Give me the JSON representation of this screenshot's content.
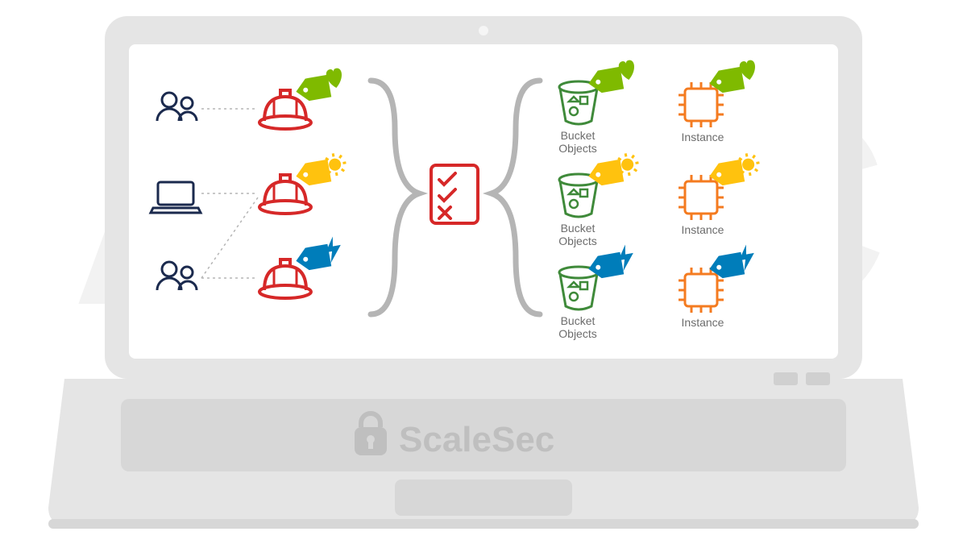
{
  "background_text": "ABAC",
  "brand": "ScaleSec",
  "resource_labels": {
    "bucket": "Bucket Objects",
    "instance": "Instance"
  },
  "colors": {
    "green": "#7fba00",
    "yellow": "#ffc20e",
    "teal": "#007dba",
    "red": "#d62828",
    "orange": "#f47b20",
    "bucket_green": "#3f8a3a",
    "gray": "#a8a8a8",
    "dark_navy": "#1b2a4e",
    "light_gray": "#e5e5e5"
  },
  "subjects": [
    {
      "type": "users",
      "tag": "green-heart"
    },
    {
      "type": "laptop",
      "tag": "yellow-sun"
    },
    {
      "type": "users",
      "tag": "teal-bolt"
    }
  ],
  "resources": [
    {
      "kind": "bucket",
      "tag": "green-heart"
    },
    {
      "kind": "instance",
      "tag": "green-heart"
    },
    {
      "kind": "bucket",
      "tag": "yellow-sun"
    },
    {
      "kind": "instance",
      "tag": "yellow-sun"
    },
    {
      "kind": "bucket",
      "tag": "teal-bolt"
    },
    {
      "kind": "instance",
      "tag": "teal-bolt"
    }
  ]
}
